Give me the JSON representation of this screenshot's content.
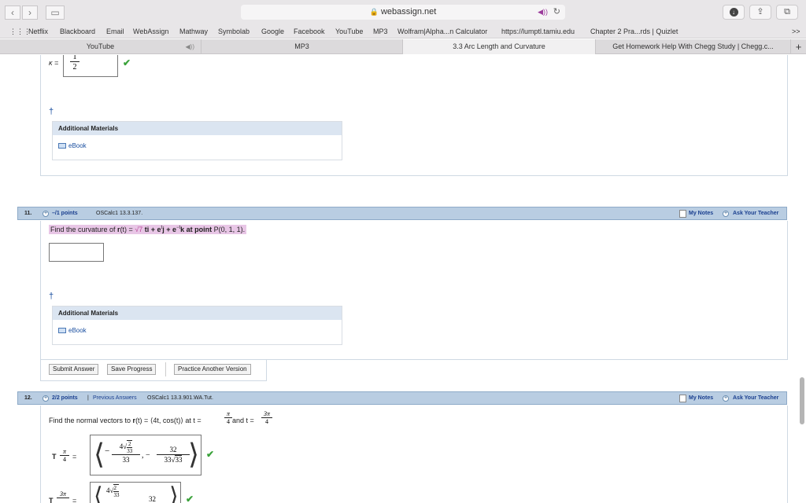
{
  "browser": {
    "url": "webassign.net",
    "bookmarks": [
      "Netflix",
      "Blackboard",
      "Email",
      "WebAssign",
      "Mathway",
      "Symbolab",
      "Google",
      "Facebook",
      "YouTube",
      "MP3",
      "Wolfram|Alpha...n Calculator",
      "https://lumptl.tamiu.edu",
      "Chapter 2 Pra...rds | Quizlet"
    ],
    "more_label": ">>",
    "tabs": [
      {
        "label": "YouTube",
        "active": false
      },
      {
        "label": "MP3",
        "active": false
      },
      {
        "label": "3.3 Arc Length and Curvature",
        "active": true
      },
      {
        "label": "Get Homework Help With Chegg Study | Chegg.c...",
        "active": false
      }
    ],
    "new_tab_label": "+"
  },
  "prev_question": {
    "kappa_label": "κ =",
    "answer_num": "1",
    "answer_den": "2",
    "dagger": "†",
    "additional_materials": "Additional Materials",
    "ebook": "eBook"
  },
  "q11": {
    "number": "11.",
    "points": "–/1 points",
    "source": "OSCalc1 13.3.137.",
    "my_notes": "My Notes",
    "ask_teacher": "Ask Your Teacher",
    "text_a": "Find the curvature of ",
    "text_r": "r",
    "text_b": "(t) = ",
    "text_sqrt": "√7",
    "text_c": " ti + e",
    "text_sup1": "t",
    "text_d": "j + e",
    "text_sup2": "−t",
    "text_e": "k at point ",
    "text_point": "P(0, 1, 1).",
    "dagger": "†",
    "additional_materials": "Additional Materials",
    "ebook": "eBook",
    "submit": "Submit Answer",
    "save": "Save Progress",
    "practice": "Practice Another Version"
  },
  "q12": {
    "number": "12.",
    "points": "2/2 points",
    "separator": "|",
    "previous_answers": "Previous Answers",
    "source": "OSCalc1 13.3.901.WA.Tut.",
    "my_notes": "My Notes",
    "ask_teacher": "Ask Your Teacher",
    "text_a": "Find the normal vectors to ",
    "text_r": "r",
    "text_b": "(t) = ⟨4t, cos(t)⟩ at t = ",
    "t1_num": "π",
    "t1_den": "4",
    "text_and": " and t = ",
    "t2_num": "3π",
    "t2_den": "4",
    "T1_label": "T",
    "T1_arg_num": "π",
    "T1_arg_den": "4",
    "T1_x_coef": "4",
    "T1_x_rad_num": "2",
    "T1_x_rad_den": "33",
    "T1_x_den": "33",
    "T1_y_num": "32",
    "T1_y_den_coef": "33",
    "T1_y_den_rad": "33",
    "T2_label": "T",
    "T2_arg_num": "3π",
    "T2_x_coef": "4",
    "T2_x_rad_num": "2",
    "T2_x_rad_den": "33",
    "T2_y_num": "32",
    "equals": "="
  }
}
